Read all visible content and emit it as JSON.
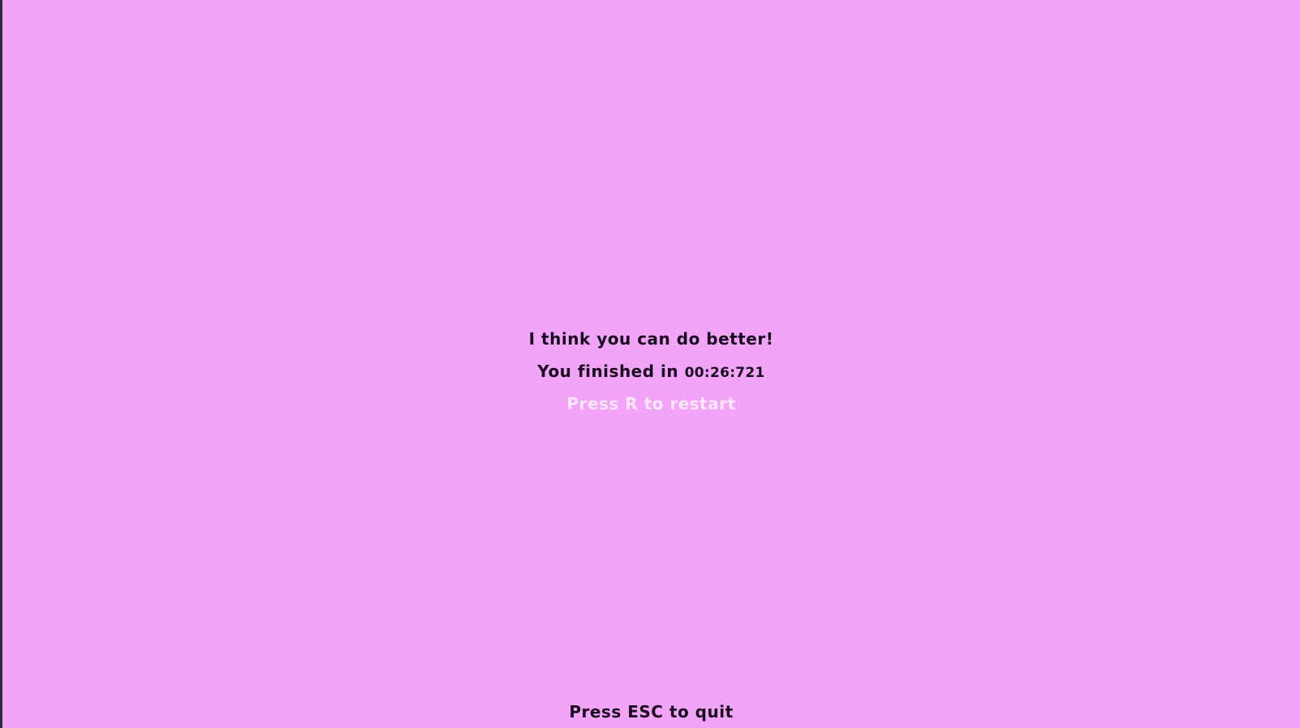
{
  "colors": {
    "background": "#f2a4f9",
    "text": "#1a0a1e",
    "restart_text": "#fde6ff"
  },
  "end_screen": {
    "headline": "I think you can do better!",
    "result_prefix": "You finished in",
    "finish_time": "00:26:721",
    "restart_prompt": "Press R to restart",
    "quit_prompt": "Press ESC to quit"
  }
}
